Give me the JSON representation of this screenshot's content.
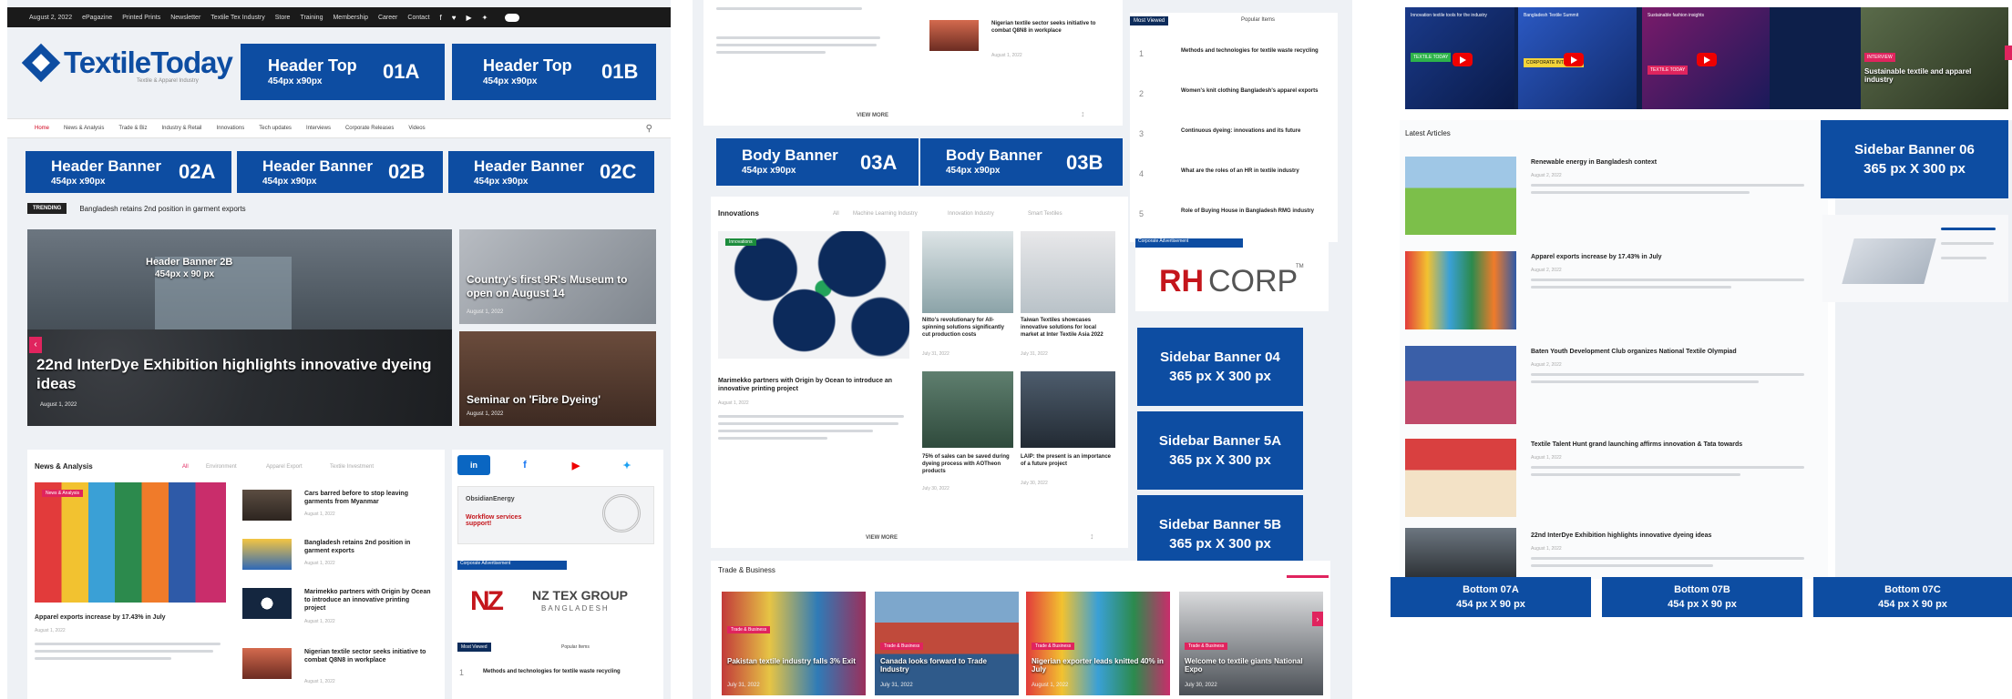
{
  "panel1": {
    "topbar": {
      "links": [
        "August 2, 2022",
        "ePagazine",
        "Printed Prints",
        "Newsletter",
        "Textile Tex Industry",
        "Store",
        "Training",
        "Membership",
        "Career",
        "Contact"
      ],
      "social_icons": [
        "f",
        "♥",
        "▶",
        "✦"
      ]
    },
    "logo": {
      "name": "TextileToday",
      "tagline": "Textile & Apparel Industry"
    },
    "banner_01a": {
      "title": "Header Top",
      "size": "454px x90px",
      "code": "01A"
    },
    "banner_01b": {
      "title": "Header Top",
      "size": "454px x90px",
      "code": "01B"
    },
    "nav": {
      "items": [
        "Home",
        "News & Analysis",
        "Trade & Biz",
        "Industry & Retail",
        "Innovations",
        "Tech updates",
        "Interviews",
        "Corporate Releases",
        "Videos"
      ]
    },
    "banner_02a": {
      "title": "Header Banner",
      "size": "454px x90px",
      "code": "02A"
    },
    "banner_02b": {
      "title": "Header Banner",
      "size": "454px x90px",
      "code": "02B"
    },
    "banner_02c": {
      "title": "Header Banner",
      "size": "454px x90px",
      "code": "02C"
    },
    "trending": {
      "tag": "TRENDING",
      "text": "Bangladesh retains 2nd position in garment exports"
    },
    "hero": {
      "overlay_title": "Header Banner 2B",
      "overlay_size": "454px x 90 px",
      "headline": "22nd InterDye Exhibition highlights innovative dyeing ideas",
      "date": "August 1, 2022"
    },
    "side_story_1": {
      "title": "Country's first 9R's Museum to open on August 14",
      "date": "August 1, 2022"
    },
    "side_story_2": {
      "title": "Seminar on 'Fibre Dyeing'",
      "date": "August 1, 2022"
    },
    "news_section": {
      "title": "News & Analysis",
      "tabs": [
        "All",
        "Environment",
        "Apparel Export",
        "Textile Investment"
      ],
      "main_headline": "Apparel exports increase by 17.43% in July",
      "main_date": "August 1, 2022",
      "items": [
        {
          "title": "Cars barred before to stop leaving garments from Myanmar",
          "date": "August 1, 2022"
        },
        {
          "title": "Bangladesh retains 2nd position in garment exports",
          "date": "August 1, 2022"
        },
        {
          "title": "Marimekko partners with Origin by Ocean to introduce an innovative printing project",
          "date": "August 1, 2022"
        },
        {
          "title": "Nigerian textile sector seeks initiative to combat Q8N8 in workplace",
          "date": "August 1, 2022"
        }
      ]
    },
    "social": {
      "icons": [
        "in",
        "f",
        "▶",
        "✦"
      ]
    },
    "ads": {
      "ad1_text": "ObsidianEnergy",
      "ad1_red": "Workflow services support!",
      "ad2_brand": "NZ TEX GROUP",
      "ad2_sub": "BANGLADESH",
      "ad_label": "Corporate Advertisement"
    },
    "most_viewed": {
      "tab1": "Most Viewed",
      "tab2": "Popular Items",
      "item1": "Methods and technologies for textile waste recycling"
    }
  },
  "panel2": {
    "top_story": {
      "title": "Nigerian textile sector seeks initiative to combat Q8N8 in workplace",
      "date": "August 1, 2022"
    },
    "view_more": "VIEW MORE",
    "most_viewed": {
      "tab1": "Most Viewed",
      "tab2": "Popular Items",
      "items": [
        {
          "rank": "1",
          "title": "Methods and technologies for textile waste recycling"
        },
        {
          "rank": "2",
          "title": "Women's knit clothing Bangladesh's apparel exports"
        },
        {
          "rank": "3",
          "title": "Continuous dyeing: innovations and its future"
        },
        {
          "rank": "4",
          "title": "What are the roles of an HR in textile industry"
        },
        {
          "rank": "5",
          "title": "Role of Buying House in Bangladesh RMG industry"
        }
      ]
    },
    "banner_03a": {
      "title": "Body Banner",
      "size": "454px x90px",
      "code": "03A"
    },
    "banner_03b": {
      "title": "Body Banner",
      "size": "454px x90px",
      "code": "03B"
    },
    "corporate_label": "Corporate Advertisement",
    "rhcorp": {
      "red": "RH",
      "dark": "CORP",
      "mark": "TM"
    },
    "banner_04": {
      "title": "Sidebar Banner 04",
      "size": "365 px X 300 px"
    },
    "banner_5a": {
      "title": "Sidebar Banner 5A",
      "size": "365 px X 300 px"
    },
    "banner_5b": {
      "title": "Sidebar Banner 5B",
      "size": "365 px X 300 px"
    },
    "innovations": {
      "title": "Innovations",
      "tabs": [
        "All",
        "Machine Learning Industry",
        "Innovation Industry",
        "Smart Textiles"
      ],
      "main_headline": "Marimekko partners with Origin by Ocean to introduce an innovative printing project",
      "main_date": "August 1, 2022",
      "items": [
        {
          "title": "Nitto's revolutionary for All-spinning solutions significantly cut production costs",
          "date": "July 31, 2022"
        },
        {
          "title": "Taiwan Textiles showcases innovative solutions for local market at Inter Textile Asia 2022",
          "date": "July 31, 2022"
        },
        {
          "title": "75% of sales can be saved during dyeing process with AOTheon products",
          "date": "July 30, 2022"
        },
        {
          "title": "LAIP: the present is an importance of a future project",
          "date": "July 30, 2022"
        }
      ]
    },
    "trade": {
      "title": "Trade & Business",
      "cards": [
        {
          "tag": "Trade & Business",
          "title": "Pakistan textile industry falls 3% Exit",
          "date": "July 31, 2022"
        },
        {
          "tag": "Trade & Business",
          "title": "Canada looks forward to Trade Industry",
          "date": "July 31, 2022"
        },
        {
          "tag": "Trade & Business",
          "title": "Nigerian exporter leads knitted 40% in July",
          "date": "August 1, 2022"
        },
        {
          "tag": "Trade & Business",
          "title": "Welcome to textile giants National Expo",
          "date": "July 30, 2022"
        }
      ]
    }
  },
  "panel3": {
    "videos": [
      {
        "title": "Innovation textile tools for the industry",
        "label": "TEXTILE TODAY"
      },
      {
        "title": "Bangladesh Textile Summit",
        "label": "CORPORATE INTERVIEW"
      },
      {
        "title": "Sustainable fashion insights",
        "label": "TEXTILE TODAY"
      },
      {
        "title": "Sustainable textile and apparel industry",
        "label": "INTERVIEW"
      }
    ],
    "latest": {
      "title": "Latest Articles",
      "items": [
        {
          "title": "Renewable energy in Bangladesh context",
          "date": "August 2, 2022"
        },
        {
          "title": "Apparel exports increase by 17.43% in July",
          "date": "August 2, 2022"
        },
        {
          "title": "Baten Youth Development Club organizes National Textile Olympiad",
          "date": "August 2, 2022"
        },
        {
          "title": "Textile Talent Hunt grand launching affirms innovation & Tata towards",
          "date": "August 1, 2022"
        },
        {
          "title": "22nd InterDye Exhibition highlights innovative dyeing ideas",
          "date": "August 1, 2022"
        }
      ]
    },
    "banner_06": {
      "title": "Sidebar Banner 06",
      "size": "365 px X 300 px"
    },
    "banner_07a": {
      "title": "Bottom 07A",
      "size": "454 px X 90 px"
    },
    "banner_07b": {
      "title": "Bottom 07B",
      "size": "454 px X 90 px"
    },
    "banner_07c": {
      "title": "Bottom 07C",
      "size": "454 px X 90 px"
    }
  },
  "colors": {
    "banner": "#0d4da2",
    "accent": "#e0245e",
    "brand_red": "#c4161c"
  }
}
